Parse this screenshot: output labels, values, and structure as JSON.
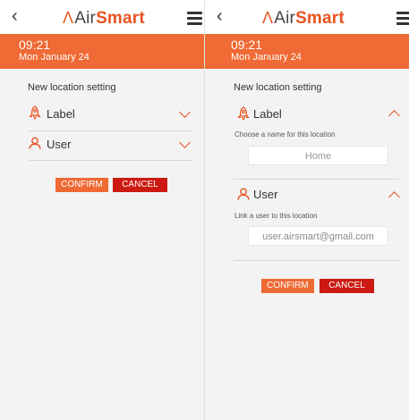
{
  "app": {
    "back_icon": "chevron-left-icon",
    "logo_prefix": "Air",
    "logo_suffix": "Smart",
    "menu_icon": "hamburger-menu-icon",
    "accent_color": "#ef6a34",
    "cancel_color": "#cc1a12"
  },
  "status": {
    "time": "09:21",
    "date": "Mon January 24"
  },
  "form": {
    "title": "New location setting",
    "label_section": {
      "label": "Label",
      "icon": "rocket-icon",
      "help": "Choose a name for this location",
      "value": "Home"
    },
    "user_section": {
      "label": "User",
      "icon": "user-icon",
      "help": "Link a user to this location",
      "value": "user.airsmart@gmail.com"
    },
    "confirm_label": "CONFIRM",
    "cancel_label": "CANCEL"
  }
}
